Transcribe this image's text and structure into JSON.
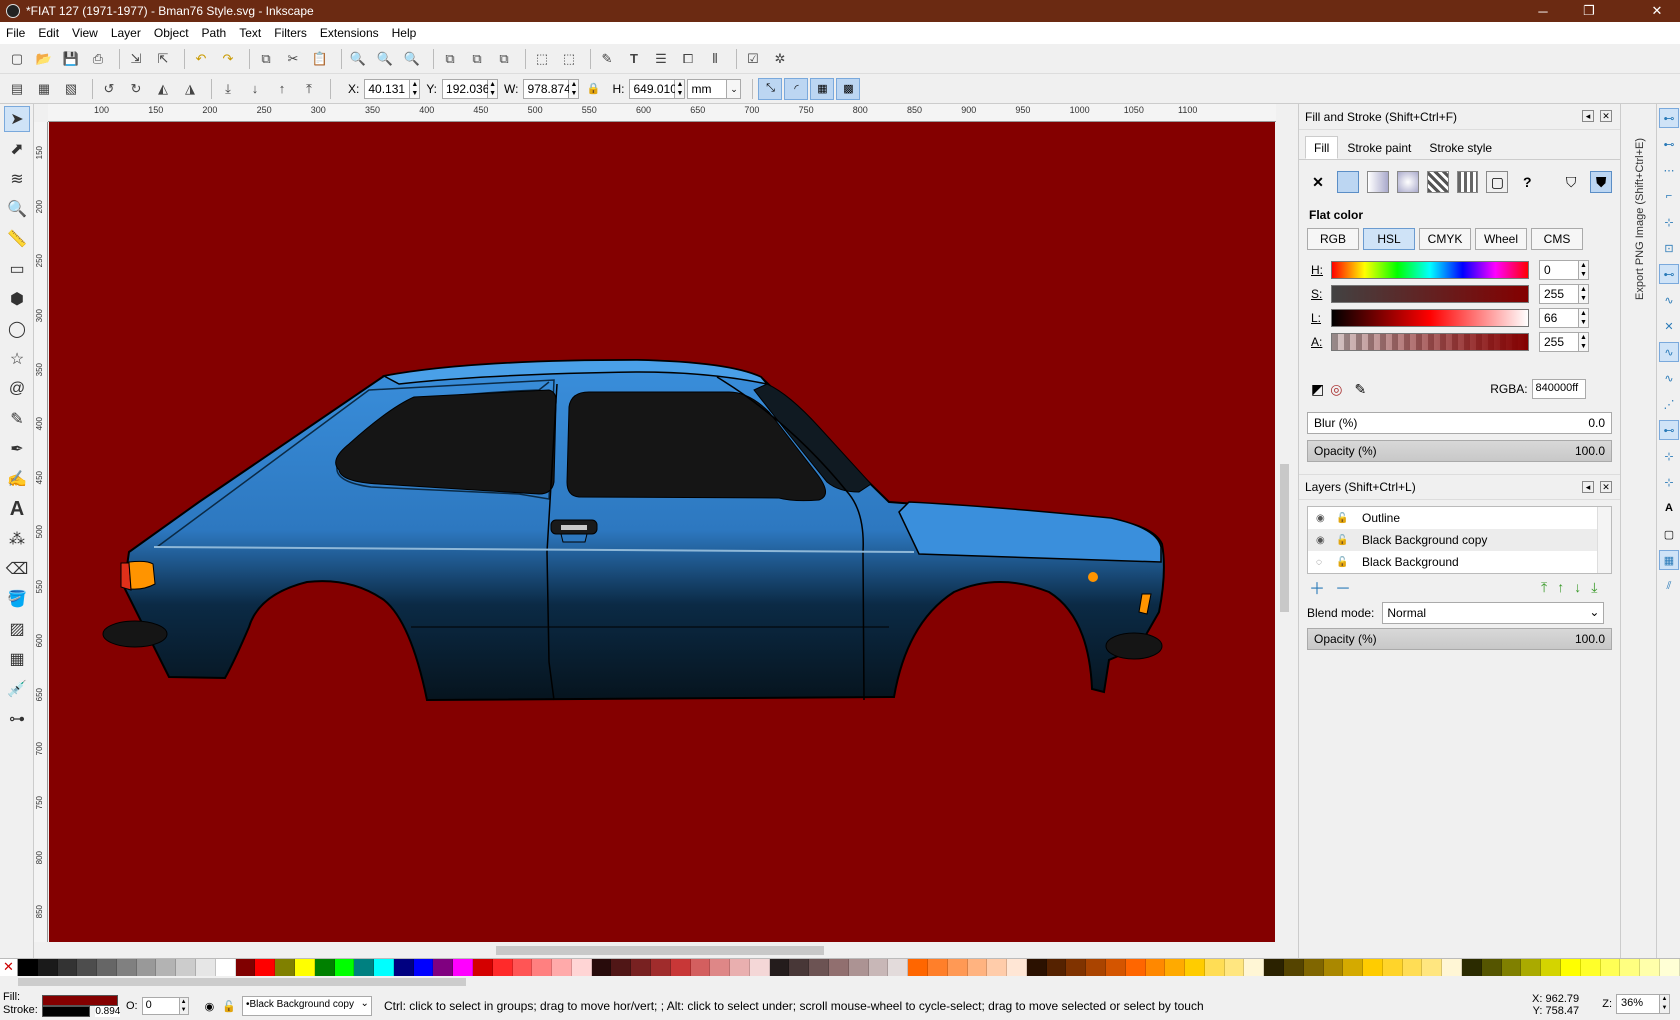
{
  "window": {
    "title": "*FIAT 127 (1971-1977) - Bman76 Style.svg - Inkscape",
    "minimize": "─",
    "maximize": "❐",
    "close": "✕"
  },
  "menu": [
    "File",
    "Edit",
    "View",
    "Layer",
    "Object",
    "Path",
    "Text",
    "Filters",
    "Extensions",
    "Help"
  ],
  "ctrl": {
    "x_label": "X:",
    "x": "40.131",
    "y_label": "Y:",
    "y": "192.036",
    "w_label": "W:",
    "w": "978.874",
    "h_label": "H:",
    "h": "649.010",
    "unit": "mm"
  },
  "ruler": {
    "h": [
      "100",
      "150",
      "200",
      "250",
      "300",
      "350",
      "400",
      "450",
      "500",
      "550",
      "600",
      "650",
      "700",
      "750",
      "800",
      "850",
      "900",
      "950",
      "1000",
      "1050",
      "1100"
    ],
    "v": [
      "150",
      "200",
      "250",
      "300",
      "350",
      "400",
      "450",
      "500",
      "550",
      "600",
      "650",
      "700",
      "750",
      "800",
      "850"
    ]
  },
  "colors": {
    "canvas": "#840000",
    "car_body": "#3a8fdc",
    "car_dark": "#06141e",
    "window": "#151515",
    "orange": "#ff9400"
  },
  "fill_stroke": {
    "title": "Fill and Stroke (Shift+Ctrl+F)",
    "tabs": [
      "Fill",
      "Stroke paint",
      "Stroke style"
    ],
    "flat_color": "Flat color",
    "modes": [
      "RGB",
      "HSL",
      "CMYK",
      "Wheel",
      "CMS"
    ],
    "selected_mode": "HSL",
    "sliders": [
      {
        "label": "H:",
        "value": "0"
      },
      {
        "label": "S:",
        "value": "255"
      },
      {
        "label": "L:",
        "value": "66"
      },
      {
        "label": "A:",
        "value": "255"
      }
    ],
    "rgba_label": "RGBA:",
    "rgba": "840000ff",
    "blur_label": "Blur (%)",
    "blur": "0.0",
    "opacity_label": "Opacity (%)",
    "opacity": "100.0",
    "unset": "?"
  },
  "layers": {
    "title": "Layers (Shift+Ctrl+L)",
    "items": [
      "Outline",
      "Black Background copy",
      "Black Background"
    ],
    "blend_label": "Blend mode:",
    "blend": "Normal",
    "opacity_label": "Opacity (%)",
    "opacity": "100.0"
  },
  "side_title": "Export PNG Image (Shift+Ctrl+E)",
  "palette": [
    "#000000",
    "#1a1a1a",
    "#333333",
    "#4d4d4d",
    "#666666",
    "#808080",
    "#999999",
    "#b3b3b3",
    "#cccccc",
    "#e6e6e6",
    "#ffffff",
    "#800000",
    "#ff0000",
    "#808000",
    "#ffff00",
    "#008000",
    "#00ff00",
    "#008080",
    "#00ffff",
    "#000080",
    "#0000ff",
    "#800080",
    "#ff00ff",
    "#d40000",
    "#ff2a2a",
    "#ff5555",
    "#ff8080",
    "#ffaaaa",
    "#ffd5d5",
    "#280b0b",
    "#501616",
    "#782121",
    "#a02c2c",
    "#c83737",
    "#d35f5f",
    "#de8787",
    "#e9afaf",
    "#f4d7d7",
    "#241c1c",
    "#483737",
    "#6c5353",
    "#916f6f",
    "#ac9393",
    "#c8b7b7",
    "#e3dbdb",
    "#ff6600",
    "#ff7f2a",
    "#ff9955",
    "#ffb380",
    "#ffccaa",
    "#ffe6d5",
    "#2b1100",
    "#552200",
    "#803300",
    "#aa4400",
    "#d45500",
    "#ff6600",
    "#ff8800",
    "#ffaa00",
    "#ffcc00",
    "#ffdd55",
    "#ffe680",
    "#fff6d5",
    "#2b2200",
    "#554400",
    "#806600",
    "#aa8800",
    "#d4aa00",
    "#ffcc00",
    "#ffd42a",
    "#ffdd55",
    "#ffe680",
    "#fff6d5",
    "#2b2b00",
    "#555500",
    "#808000",
    "#aaaa00",
    "#d4d400",
    "#ffff00",
    "#ffff2a",
    "#ffff55",
    "#ffff80",
    "#ffffaa",
    "#ffffd5"
  ],
  "status": {
    "fill_label": "Fill:",
    "stroke_label": "Stroke:",
    "stroke_width": "0.894",
    "o_label": "O:",
    "o_value": "0",
    "layer": "•Black Background copy",
    "message": "Ctrl: click to select in groups; drag to move hor/vert; ; Alt: click to select under; scroll mouse-wheel to cycle-select; drag to move selected or select by touch",
    "cx_label": "X:",
    "cx": "962.79",
    "cy_label": "Y:",
    "cy": "758.47",
    "z_label": "Z:",
    "zoom": "36%"
  }
}
